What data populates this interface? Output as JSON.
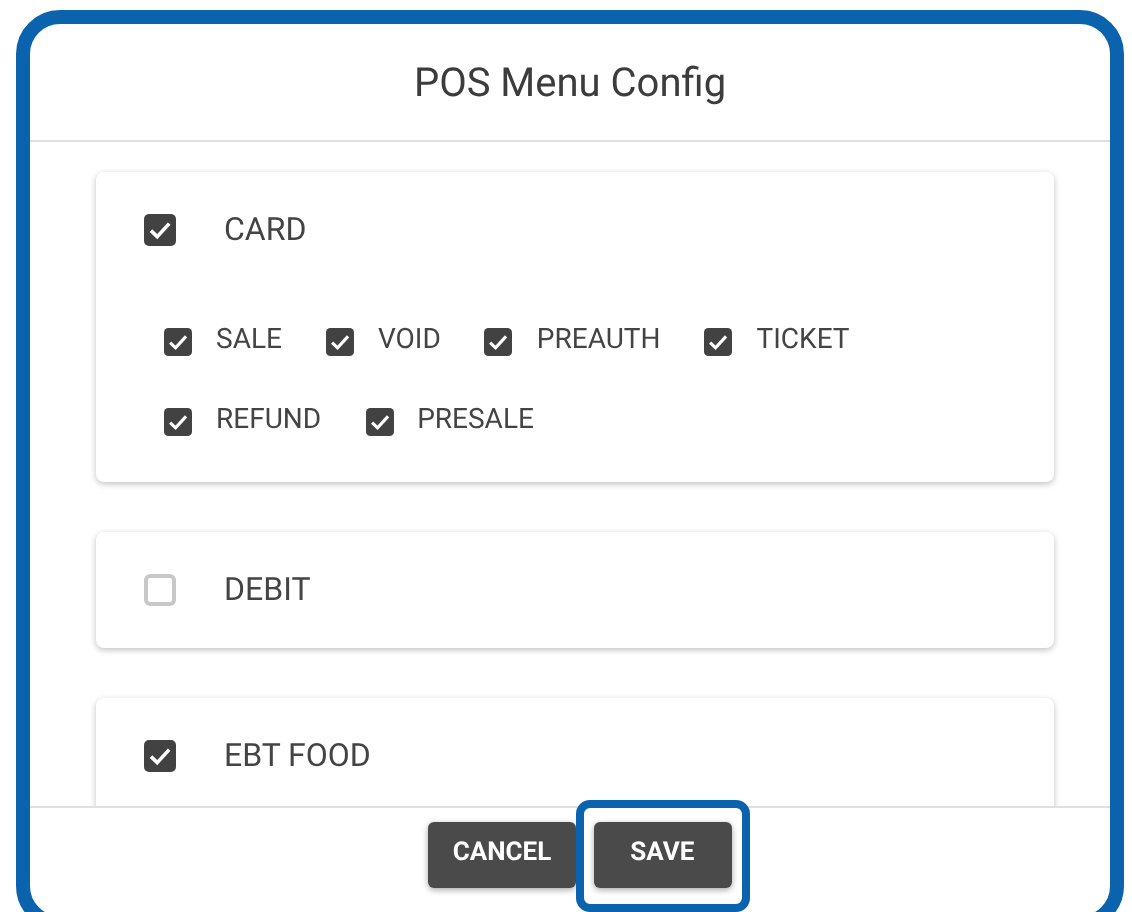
{
  "title": "POS Menu Config",
  "groups": [
    {
      "label": "CARD",
      "checked": true,
      "options": [
        {
          "label": "SALE",
          "checked": true
        },
        {
          "label": "VOID",
          "checked": true
        },
        {
          "label": "PREAUTH",
          "checked": true
        },
        {
          "label": "TICKET",
          "checked": true
        },
        {
          "label": "REFUND",
          "checked": true
        },
        {
          "label": "PRESALE",
          "checked": true
        }
      ]
    },
    {
      "label": "DEBIT",
      "checked": false
    },
    {
      "label": "EBT FOOD",
      "checked": true
    }
  ],
  "buttons": [
    {
      "label": "CANCEL",
      "highlighted": false
    },
    {
      "label": "SAVE",
      "highlighted": true
    }
  ]
}
